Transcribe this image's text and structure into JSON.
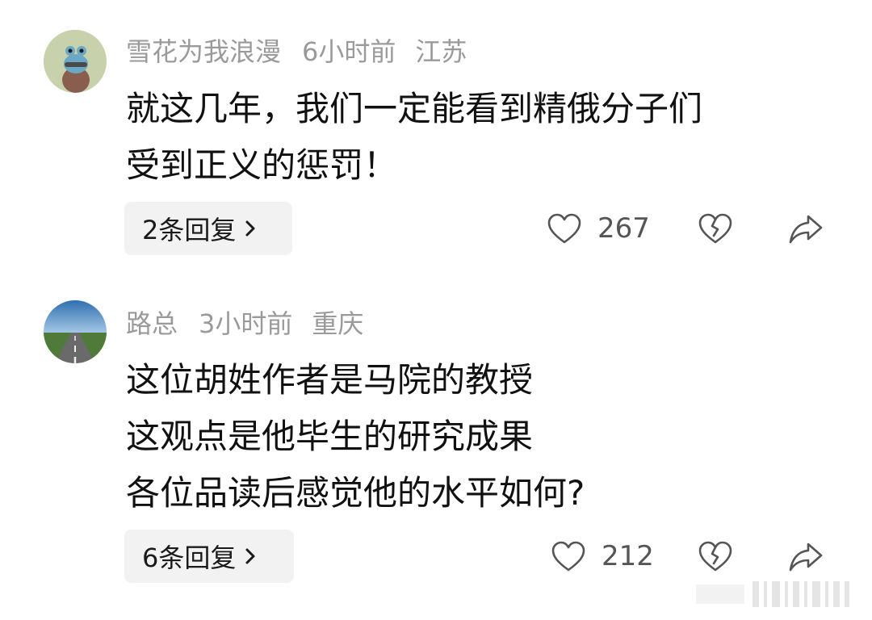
{
  "comments": [
    {
      "username": "雪花为我浪漫",
      "time": "6小时前",
      "location": "江苏",
      "content_lines": [
        "就这几年，我们一定能看到精俄分子们",
        "受到正义的惩罚！"
      ],
      "replies_label": "2条回复",
      "like_count": "267",
      "avatar": "avatar-cartoon-figure"
    },
    {
      "username": "路总",
      "time": "3小时前",
      "location": "重庆",
      "content_lines": [
        "这位胡姓作者是马院的教授",
        "这观点是他毕生的研究成果",
        "各位品读后感觉他的水平如何?"
      ],
      "replies_label": "6条回复",
      "like_count": "212",
      "avatar": "avatar-road-landscape"
    }
  ],
  "icons": {
    "like": "heart-outline-icon",
    "dislike": "broken-heart-icon",
    "share": "share-arrow-icon",
    "reply_chevron": "chevron-right-icon"
  },
  "colors": {
    "meta_text": "#9a9a9a",
    "body_text": "#111111",
    "reply_bg": "#f2f2f2",
    "icon_stroke": "#555555"
  }
}
